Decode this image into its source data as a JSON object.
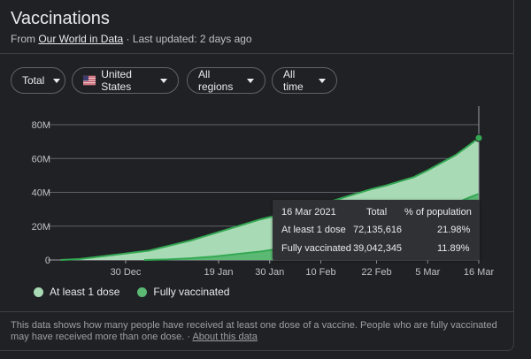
{
  "header": {
    "title": "Vaccinations",
    "source_prefix": "From",
    "source_link": "Our World in Data",
    "updated": "· Last updated: 2 days ago"
  },
  "filters": {
    "metric": "Total",
    "country": "United States",
    "regions": "All regions",
    "time": "All time"
  },
  "chart_data": {
    "type": "area",
    "title": "",
    "xlabel": "",
    "ylabel": "",
    "ylim": [
      0,
      80000000
    ],
    "y_ticks": [
      "0",
      "20M",
      "40M",
      "60M",
      "80M"
    ],
    "y_tick_values": [
      0,
      20000000,
      40000000,
      60000000,
      80000000
    ],
    "x_ticks": [
      "30 Dec",
      "19 Jan",
      "30 Jan",
      "10 Feb",
      "22 Feb",
      "5 Mar",
      "16 Mar"
    ],
    "x_tick_days": [
      16,
      36,
      47,
      58,
      70,
      81,
      92
    ],
    "x_axis_start": "2020-12-14",
    "x_range_days": [
      0,
      92
    ],
    "grid": true,
    "legend_position": "bottom",
    "colors": {
      "dose1": "#a8dab5",
      "full": "#5bb974",
      "line": "#34a853"
    },
    "series": [
      {
        "name": "At least 1 dose",
        "x": [
          2,
          6,
          9,
          12,
          15,
          18,
          21,
          24,
          27,
          30,
          33,
          36,
          39,
          42,
          45,
          48,
          51,
          54,
          57,
          60,
          63,
          66,
          69,
          72,
          75,
          78,
          81,
          84,
          87,
          90,
          92
        ],
        "values": [
          0,
          500000,
          1500000,
          2500000,
          3500000,
          4500000,
          5500000,
          7500000,
          9500000,
          11500000,
          14000000,
          16500000,
          19000000,
          21500000,
          24000000,
          26000000,
          28000000,
          30000000,
          32000000,
          34500000,
          37000000,
          39500000,
          42000000,
          44000000,
          46500000,
          49000000,
          53000000,
          57500000,
          62000000,
          68000000,
          72135616
        ]
      },
      {
        "name": "Fully vaccinated",
        "x": [
          20,
          25,
          30,
          35,
          40,
          45,
          50,
          55,
          60,
          65,
          70,
          75,
          80,
          85,
          90,
          92
        ],
        "values": [
          0,
          300000,
          1000000,
          2000000,
          3500000,
          5000000,
          7000000,
          9000000,
          12000000,
          15000000,
          18000000,
          22000000,
          26000000,
          31000000,
          37000000,
          39042345
        ]
      }
    ]
  },
  "tooltip": {
    "date": "16 Mar 2021",
    "col_total": "Total",
    "col_pct": "% of population",
    "rows": [
      {
        "label": "At least 1 dose",
        "total": "72,135,616",
        "pct": "21.98%"
      },
      {
        "label": "Fully vaccinated",
        "total": "39,042,345",
        "pct": "11.89%"
      }
    ]
  },
  "legend": {
    "dose1": "At least 1 dose",
    "full": "Fully vaccinated"
  },
  "footer": {
    "note": "This data shows how many people have received at least one dose of a vaccine. People who are fully vaccinated may have received more than one dose.",
    "separator": "·",
    "about": "About this data"
  }
}
